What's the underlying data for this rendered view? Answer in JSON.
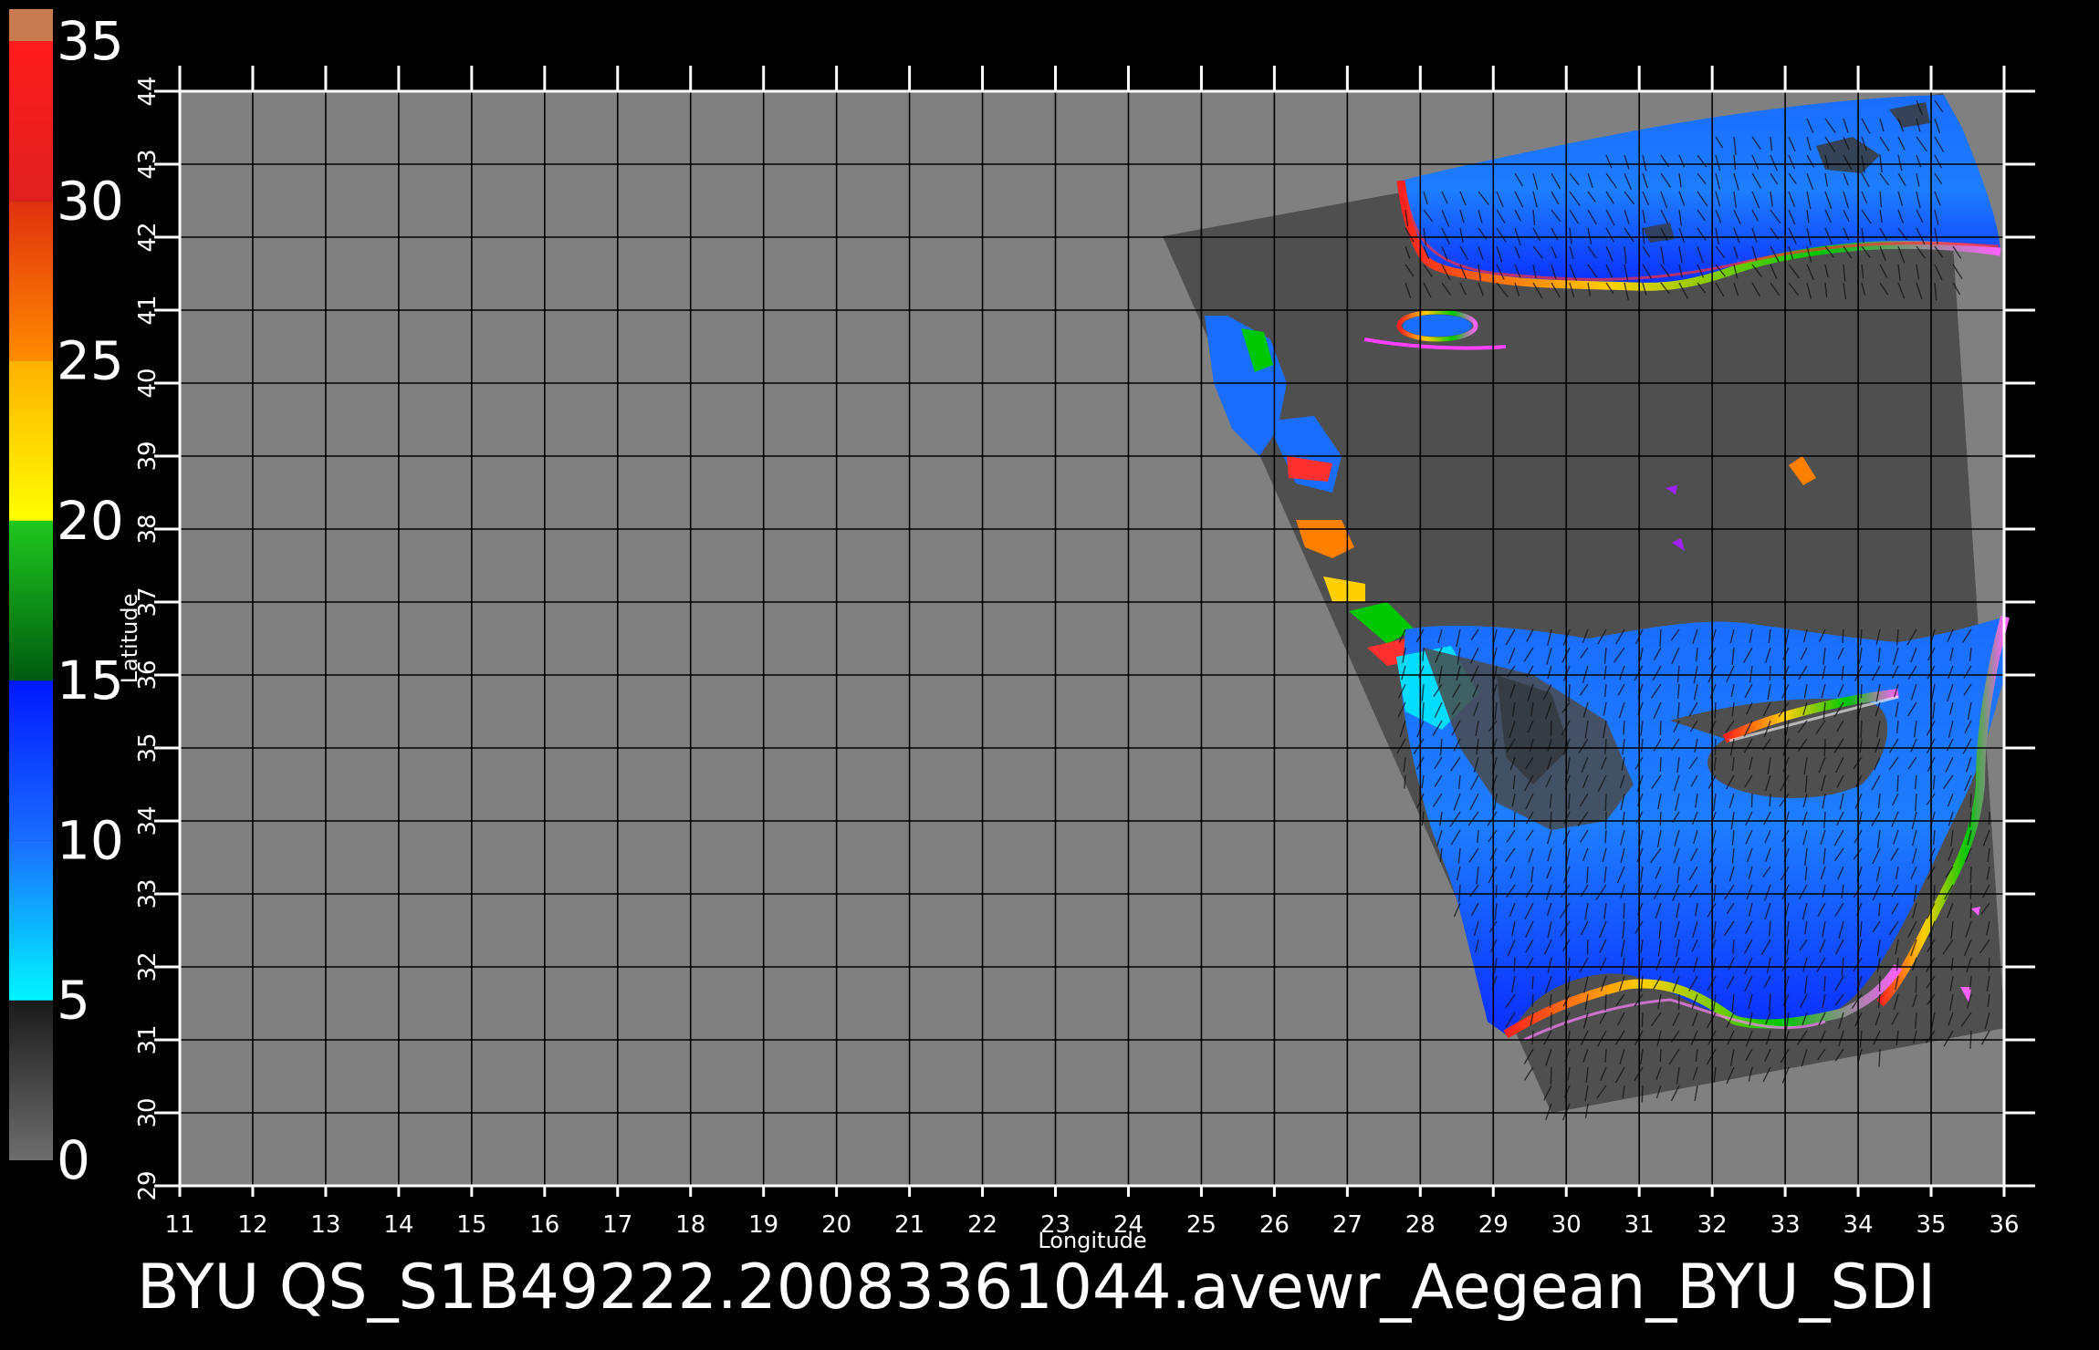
{
  "map": {
    "title": "BYU QS_S1B49222.20083361044.avewr_Aegean_BYU_SDI",
    "xlabel": "Longitude",
    "ylabel": "Latitude",
    "lon_range": [
      11,
      36
    ],
    "lat_range": [
      29,
      44
    ],
    "lon_ticks": [
      "11",
      "12",
      "13",
      "14",
      "15",
      "16",
      "17",
      "18",
      "19",
      "20",
      "21",
      "22",
      "23",
      "24",
      "25",
      "26",
      "27",
      "28",
      "29",
      "30",
      "31",
      "32",
      "33",
      "34",
      "35",
      "36"
    ],
    "lat_ticks": [
      "29",
      "30",
      "31",
      "32",
      "33",
      "34",
      "35",
      "36",
      "37",
      "38",
      "39",
      "40",
      "41",
      "42",
      "43",
      "44"
    ],
    "grid": true,
    "background_color": "#808080",
    "swath_color": "#4f4f4f"
  },
  "colorbar": {
    "range": [
      0,
      35
    ],
    "labels": [
      "0",
      "5",
      "10",
      "15",
      "20",
      "25",
      "30",
      "35"
    ],
    "segments": [
      {
        "from": 0,
        "to": 5,
        "colors": [
          "#6e6e6e",
          "#1a1a1a"
        ]
      },
      {
        "from": 5,
        "to": 10,
        "colors": [
          "#00f6ff",
          "#1a6dff"
        ]
      },
      {
        "from": 10,
        "to": 15,
        "colors": [
          "#1a6dff",
          "#0018ff"
        ]
      },
      {
        "from": 15,
        "to": 20,
        "colors": [
          "#005a10",
          "#1fc81f"
        ]
      },
      {
        "from": 20,
        "to": 25,
        "colors": [
          "#ffff00",
          "#ffb000"
        ]
      },
      {
        "from": 25,
        "to": 30,
        "colors": [
          "#ff8c00",
          "#e0300e"
        ]
      },
      {
        "from": 30,
        "to": 35,
        "colors": [
          "#e02020",
          "#ff1c1c"
        ]
      },
      {
        "from": 35,
        "to": 36,
        "colors": [
          "#c87a50",
          "#c87a50"
        ]
      }
    ]
  }
}
